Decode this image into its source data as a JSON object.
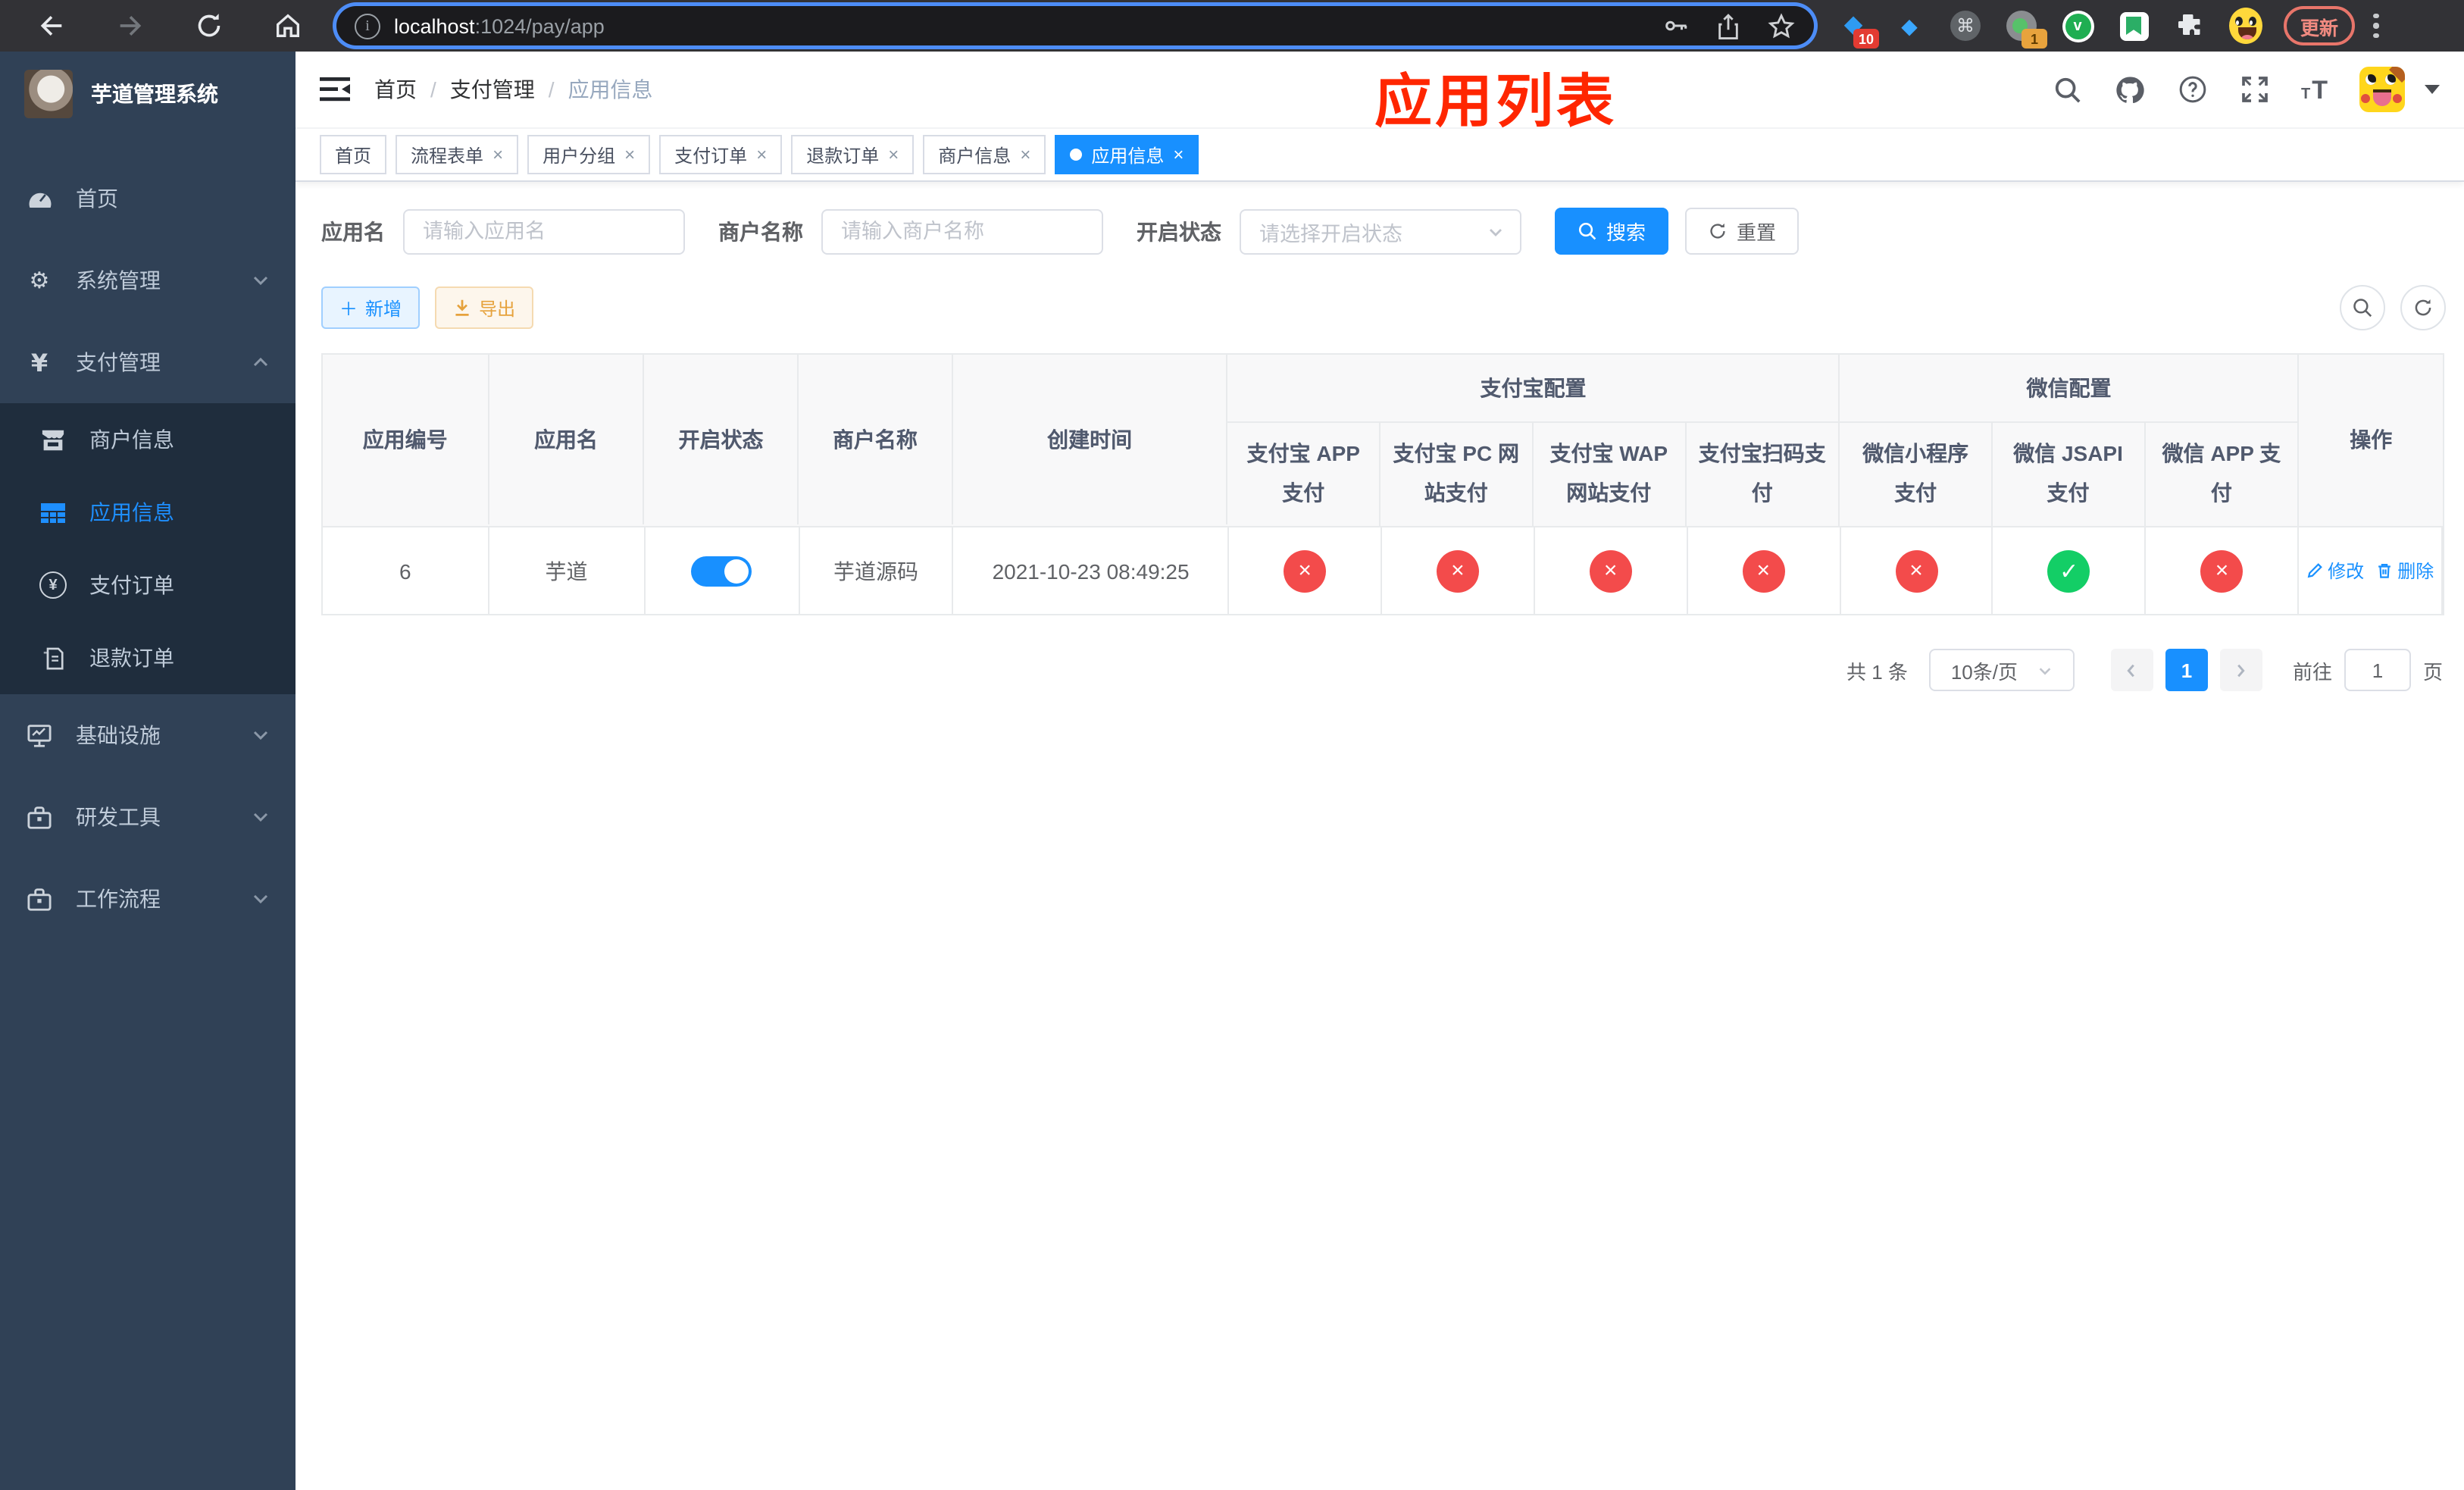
{
  "colors": {
    "accent": "#1890ff",
    "success": "#13ce66",
    "danger": "#f34b4b",
    "warning": "#e6a23c",
    "annotation_red": "#ff2600"
  },
  "browser": {
    "url_host": "localhost",
    "url_path": ":1024/pay/app",
    "update_label": "更新",
    "sketch_badge": "10",
    "recorder_badge": "1"
  },
  "sidebar": {
    "title": "芋道管理系统",
    "home": "首页",
    "system": "系统管理",
    "pay": "支付管理",
    "merchant": "商户信息",
    "app_info": "应用信息",
    "pay_order": "支付订单",
    "refund_order": "退款订单",
    "infra": "基础设施",
    "dev_tools": "研发工具",
    "workflow": "工作流程"
  },
  "navbar": {
    "breadcrumb_home": "首页",
    "breadcrumb_section": "支付管理",
    "breadcrumb_current": "应用信息",
    "separator": "/"
  },
  "annotation": "应用列表",
  "tabs": [
    {
      "label": "首页"
    },
    {
      "label": "流程表单"
    },
    {
      "label": "用户分组"
    },
    {
      "label": "支付订单"
    },
    {
      "label": "退款订单"
    },
    {
      "label": "商户信息"
    },
    {
      "label": "应用信息"
    }
  ],
  "filters": {
    "app_name_label": "应用名",
    "app_name_placeholder": "请输入应用名",
    "merchant_label": "商户名称",
    "merchant_placeholder": "请输入商户名称",
    "status_label": "开启状态",
    "status_placeholder": "请选择开启状态",
    "search_label": "搜索",
    "reset_label": "重置"
  },
  "toolbar": {
    "add_label": "新增",
    "export_label": "导出"
  },
  "table": {
    "columns": {
      "id": "应用编号",
      "name": "应用名",
      "status": "开启状态",
      "merchant": "商户名称",
      "created": "创建时间",
      "actions": "操作"
    },
    "groups": {
      "alipay": "支付宝配置",
      "wechat": "微信配置"
    },
    "subcolumns": {
      "alipay_app": "支付宝 APP 支付",
      "alipay_pc": "支付宝 PC 网站支付",
      "alipay_wap": "支付宝 WAP 网站支付",
      "alipay_qr": "支付宝扫码支付",
      "wx_lite": "微信小程序支付",
      "wx_jsapi": "微信 JSAPI 支付",
      "wx_app": "微信 APP 支付"
    },
    "row": {
      "id": "6",
      "name": "芋道",
      "merchant": "芋道源码",
      "created": "2021-10-23 08:49:25",
      "edit_label": "修改",
      "delete_label": "删除"
    }
  },
  "glyphs": {
    "cross": "×",
    "check": "✓"
  },
  "pagination": {
    "total": "共 1 条",
    "page_size": "10条/页",
    "current_page": "1",
    "goto_label": "前往",
    "goto_value": "1",
    "page_unit": "页"
  }
}
